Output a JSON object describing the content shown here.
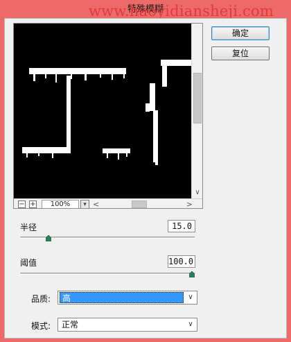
{
  "window": {
    "title": "特殊模糊"
  },
  "watermark": {
    "text": "www.haoyidiansheji.com"
  },
  "buttons": {
    "ok": "确定",
    "reset": "复位"
  },
  "preview": {
    "zoom_out": "−",
    "zoom_in": "+",
    "zoom": "100%",
    "zoom_dropdown": "▾",
    "h_left": "<",
    "h_right": ">",
    "v_down": "∨"
  },
  "params": {
    "radius": {
      "label": "半径",
      "value": "15.0",
      "slider_fraction": 0.15
    },
    "threshold": {
      "label": "阈值",
      "value": "100.0",
      "slider_fraction": 1.0
    }
  },
  "quality": {
    "label": "品质:",
    "value": "高",
    "dropdown": "∨"
  },
  "mode": {
    "label": "模式:",
    "value": "正常",
    "dropdown": "∨"
  }
}
